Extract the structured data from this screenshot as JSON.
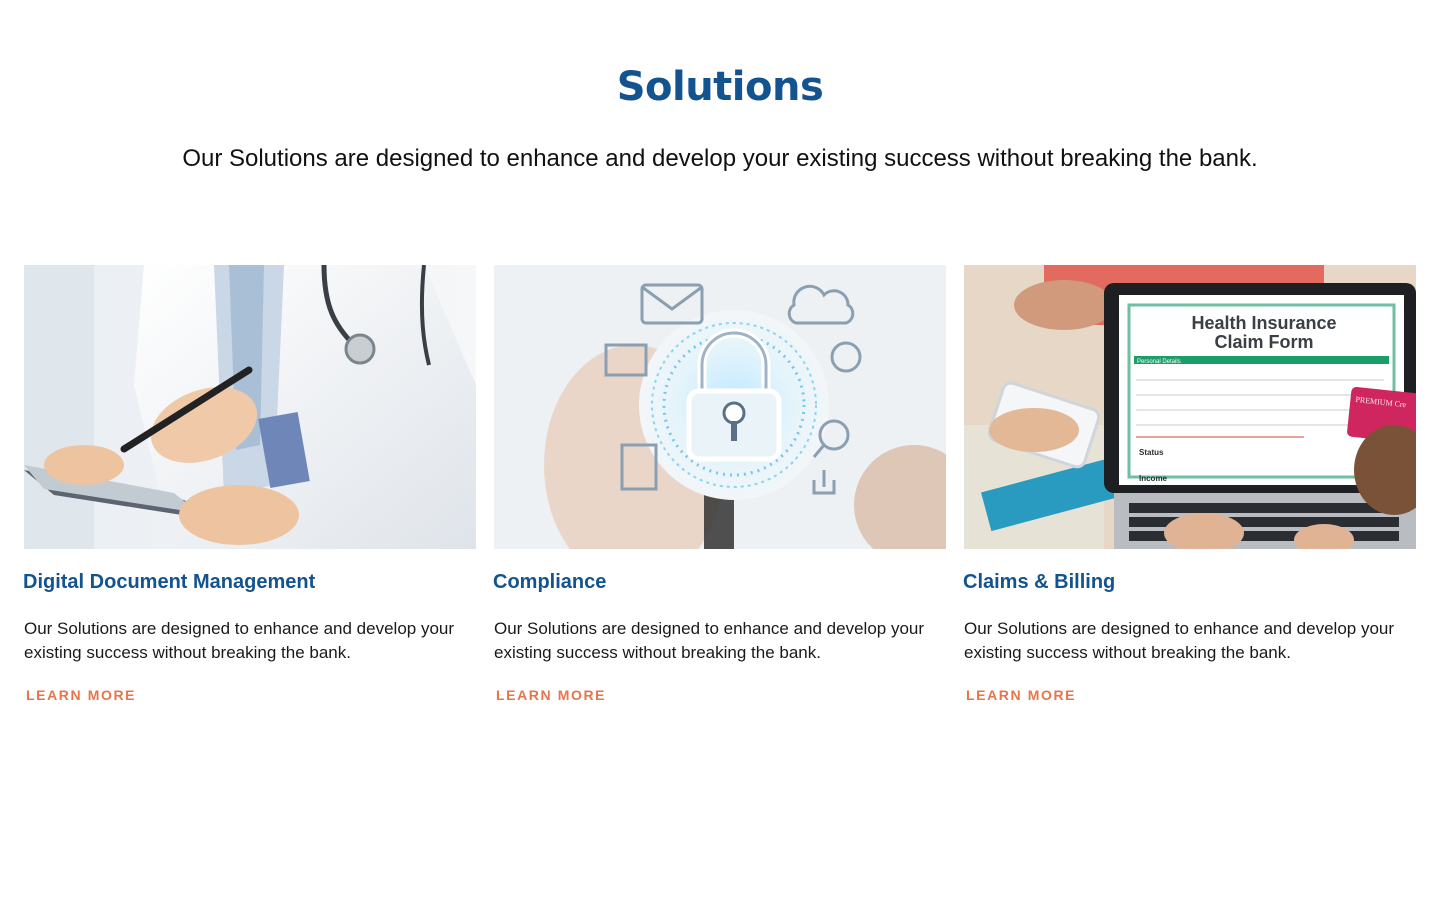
{
  "section": {
    "title": "Solutions",
    "subtitle": "Our Solutions are designed to enhance and develop your existing success without breaking the bank."
  },
  "cards": [
    {
      "title": "Digital Document Management",
      "description": "Our Solutions are designed to enhance and develop your existing success without breaking the bank.",
      "link_label": "LEARN MORE",
      "image": "doctor-with-tablet-photo"
    },
    {
      "title": "Compliance",
      "description": "Our Solutions are designed to enhance and develop your existing success without breaking the bank.",
      "link_label": "LEARN MORE",
      "image": "security-lock-photo"
    },
    {
      "title": "Claims & Billing",
      "description": "Our Solutions are designed to enhance and develop your existing success without breaking the bank.",
      "link_label": "LEARN MORE",
      "image": "insurance-claim-laptop-photo",
      "image_text": {
        "form_title_line1": "Health Insurance",
        "form_title_line2": "Claim Form",
        "personal_details": "Personal Details",
        "status": "Status",
        "income": "Income",
        "card_brand": "PREMIUM Cre"
      }
    }
  ],
  "colors": {
    "heading": "#135390",
    "link": "#e8744a",
    "text": "#1a1a1a"
  }
}
